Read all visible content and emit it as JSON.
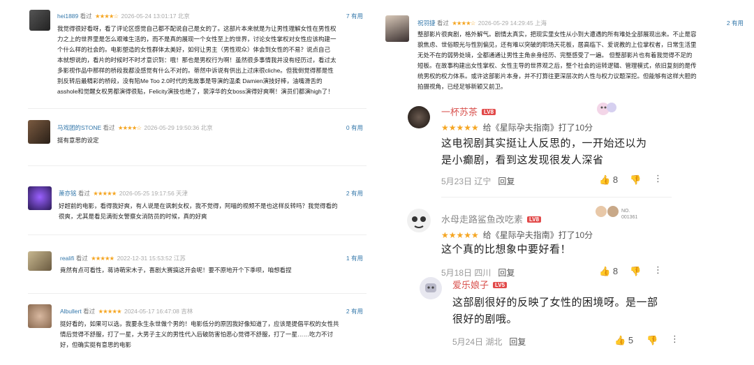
{
  "douban": [
    {
      "user": "hei1889",
      "action": "看过",
      "stars": "★★★★☆",
      "meta": "2026-05-24 13:01:17 北京",
      "useful": "7 有用",
      "lines": [
        "我觉得很好看呀，看了评论区感觉自己都不配说自己是女的了。这部片本来就是为让男性理解女性在男性权",
        "力之上的世界里是怎么艰难生活的，而不是真的展现一个女性至上的世界，讨论女性掌权对女性应该构建一",
        "个什么样的社会的。电影塑造的女性群体太美好，如何让男主（男性观众）体会到女性的不易？说点自己",
        "本就想说的，看片的时候时不时才意识到：哦！那也是男权行为啊！虽然很多事情我并没有经历过，看过太",
        "多影视作品中那样的桥段我都没感觉有什么不对的。蒂然中诉说有供出上过床很cliche。但我倒觉得那是性",
        "别反转后最精彩的桥段，没有陷Me Too 2.0时代的鬼故事是导演的温柔 Damien演技好棒，油嘴滑舌的",
        "asshole和觉醒女权男都演得很贴，Felicity演技也绝了，裴淳华的女boss演得好爽啊！演员们都演high了！"
      ]
    },
    {
      "user": "马戏团的STONE",
      "action": "看过",
      "stars": "★★★★☆",
      "meta": "2026-05-29 19:50:36 北京",
      "useful": "0 有用",
      "lines": [
        "挺有意思的设定"
      ]
    },
    {
      "user": "萧亦铭",
      "action": "看过",
      "stars": "★★★★★",
      "meta": "2026-05-25 19:17:56 天津",
      "useful": "2 有用",
      "lines": [
        "好超前的电影，看得我好爽，有人说是在讽刺女权，我不觉得，阿喵的视频不是也这样反转吗？我觉得看的",
        "很爽，尤其是看见满街女警察女消防员的时候，真的好爽"
      ]
    },
    {
      "user": "realifi",
      "action": "看过",
      "stars": "★★★★★",
      "meta": "2022-12-31 15:53:52 江苏",
      "useful": "1 有用",
      "lines": [
        "竟然有点可看性，蒋诗萌宋木子，喜剧大赛搞这开会呢！要不原地开个下季呗，咱想看捏"
      ]
    },
    {
      "user": "Albullert",
      "action": "看过",
      "stars": "★★★★★",
      "meta": "2024-05-17 16:47:08 吉林",
      "useful": "2 有用",
      "lines": [
        "挺好看的，如果可以选，我要永生永世做个男的！电影低分的原因我好像知道了，应该是提倡平权的女性共",
        "情后觉得不舒服，打了一星，大男子主义的男性代入后破防害怕恶心觉得不舒服，打了一星……吃力不讨",
        "好，但确实挺有意思的电影"
      ]
    }
  ],
  "douban_right": {
    "user": "祝羽捷",
    "action": "看过",
    "stars": "★★★★☆",
    "meta": "2026-05-29 14:29:45 上海",
    "useful": "2 有用",
    "lines": [
      "整部影片很爽剧，格外解气。剧情太真实，把现实里女性从小到大遭遇的所有难处全部展现出来。不止是容",
      "貌焦虑、世俗眼光与性别偏见，还有难以突破的职场天花板，居高临下、爱说教的上位掌权者，日常生活里",
      "无处不在的弱势处境，全都通通让男性主角亲身经历、完整感受了一遍。 但整部影片也有着我觉得不足的",
      "短板。在故事构建出女性掌权、女性主导的世界观之后，整个社会的运转逻辑、管理模式，依旧复刻的是传",
      "统男权的权力体系。或许这部影片本身，并不打算往更深层次的人性与权力议题深挖。但能够有这样大胆的",
      "拍摄视角，已经足够新颖又前卫。"
    ]
  },
  "app": [
    {
      "name": "一杯苏茶",
      "level": "LV8",
      "rating_text": "给《星际孕夫指南》打了10分",
      "stars": "★★★★★",
      "lines": [
        "这电视剧其实挺让人反思的，一开始还以为",
        "是小癫剧，看到这发现很发人深省"
      ],
      "date": "5月23日",
      "loc": "辽宁",
      "reply": "回复",
      "likes": "8"
    },
    {
      "name": "水母走路鲨鱼改吃素",
      "level": "LV8",
      "rating_text": "给《星际孕夫指南》打了10分",
      "stars": "★★★★★",
      "lines": [
        "这个真的比想象中要好看！"
      ],
      "date": "5月18日",
      "loc": "四川",
      "reply": "回复",
      "likes": "8",
      "badge": "NO. 001361"
    },
    {
      "name": "爱乐娘子",
      "level": "LV5",
      "lines": [
        "这部剧很好的反映了女性的困境呀。是一部",
        "很好的剧哦。"
      ],
      "date": "5月24日",
      "loc": "湖北",
      "reply": "回复",
      "likes": "5"
    }
  ],
  "colors": {
    "accent_blue": "#3377aa",
    "star": "#f5a623",
    "name_red": "#d9534f",
    "level_bg": "#e24a4a"
  }
}
